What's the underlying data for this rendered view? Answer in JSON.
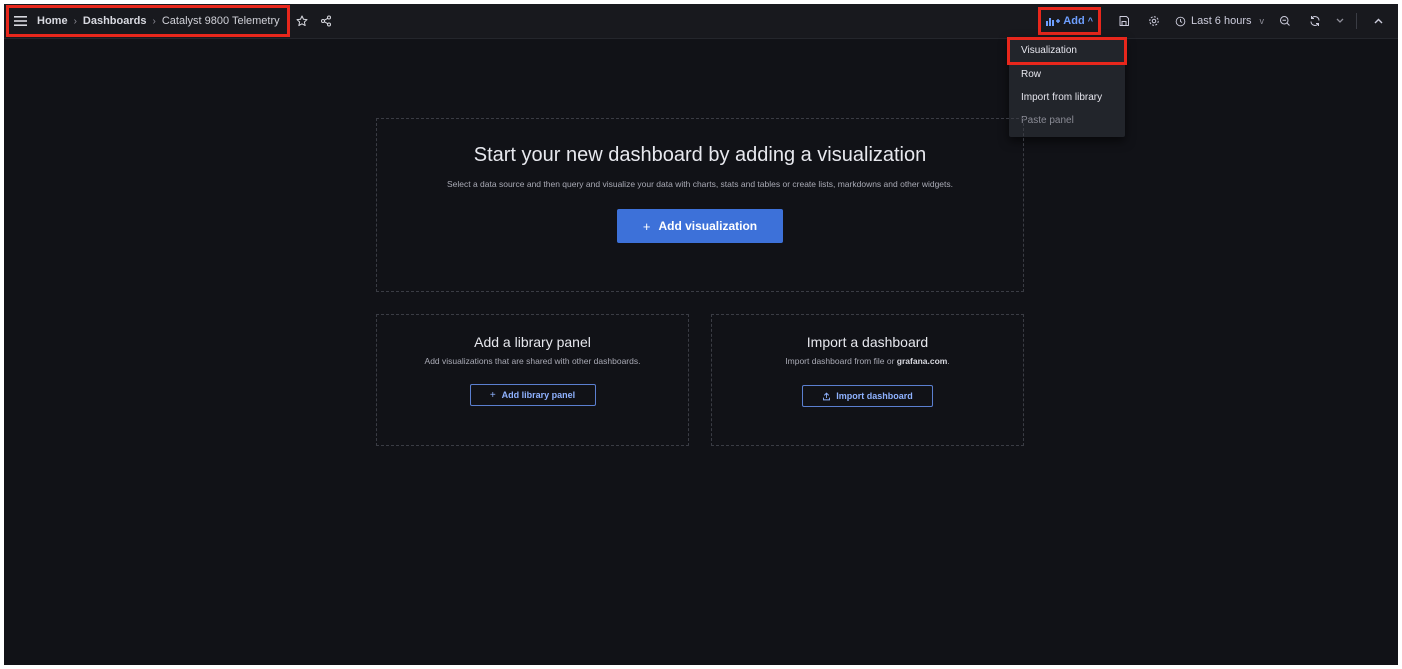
{
  "breadcrumb": {
    "home": "Home",
    "dashboards": "Dashboards",
    "current": "Catalyst 9800 Telemetry"
  },
  "toolbar": {
    "add_label": "Add",
    "time_range": "Last 6 hours"
  },
  "add_menu": {
    "items": [
      {
        "label": "Visualization"
      },
      {
        "label": "Row"
      },
      {
        "label": "Import from library"
      },
      {
        "label": "Paste panel"
      }
    ]
  },
  "empty_state": {
    "title": "Start your new dashboard by adding a visualization",
    "description": "Select a data source and then query and visualize your data with charts, stats and tables or create lists, markdowns and other widgets.",
    "button_label": "Add visualization"
  },
  "library_panel": {
    "title": "Add a library panel",
    "description": "Add visualizations that are shared with other dashboards.",
    "button_label": "Add library panel"
  },
  "import_panel": {
    "title": "Import a dashboard",
    "description_prefix": "Import dashboard from file or ",
    "description_link": "grafana.com",
    "description_suffix": ".",
    "button_label": "Import dashboard"
  },
  "colors": {
    "background": "#111217",
    "topbar": "#18191e",
    "primary": "#3d71d9",
    "accent_text": "#6e9fff",
    "highlight": "#e8271c",
    "menu": "#22252b"
  },
  "icons": [
    "menu-icon",
    "star-icon",
    "share-icon",
    "add-panel-icon",
    "save-icon",
    "settings-icon",
    "clock-icon",
    "zoom-out-icon",
    "refresh-icon",
    "collapse-icon",
    "upload-icon"
  ]
}
